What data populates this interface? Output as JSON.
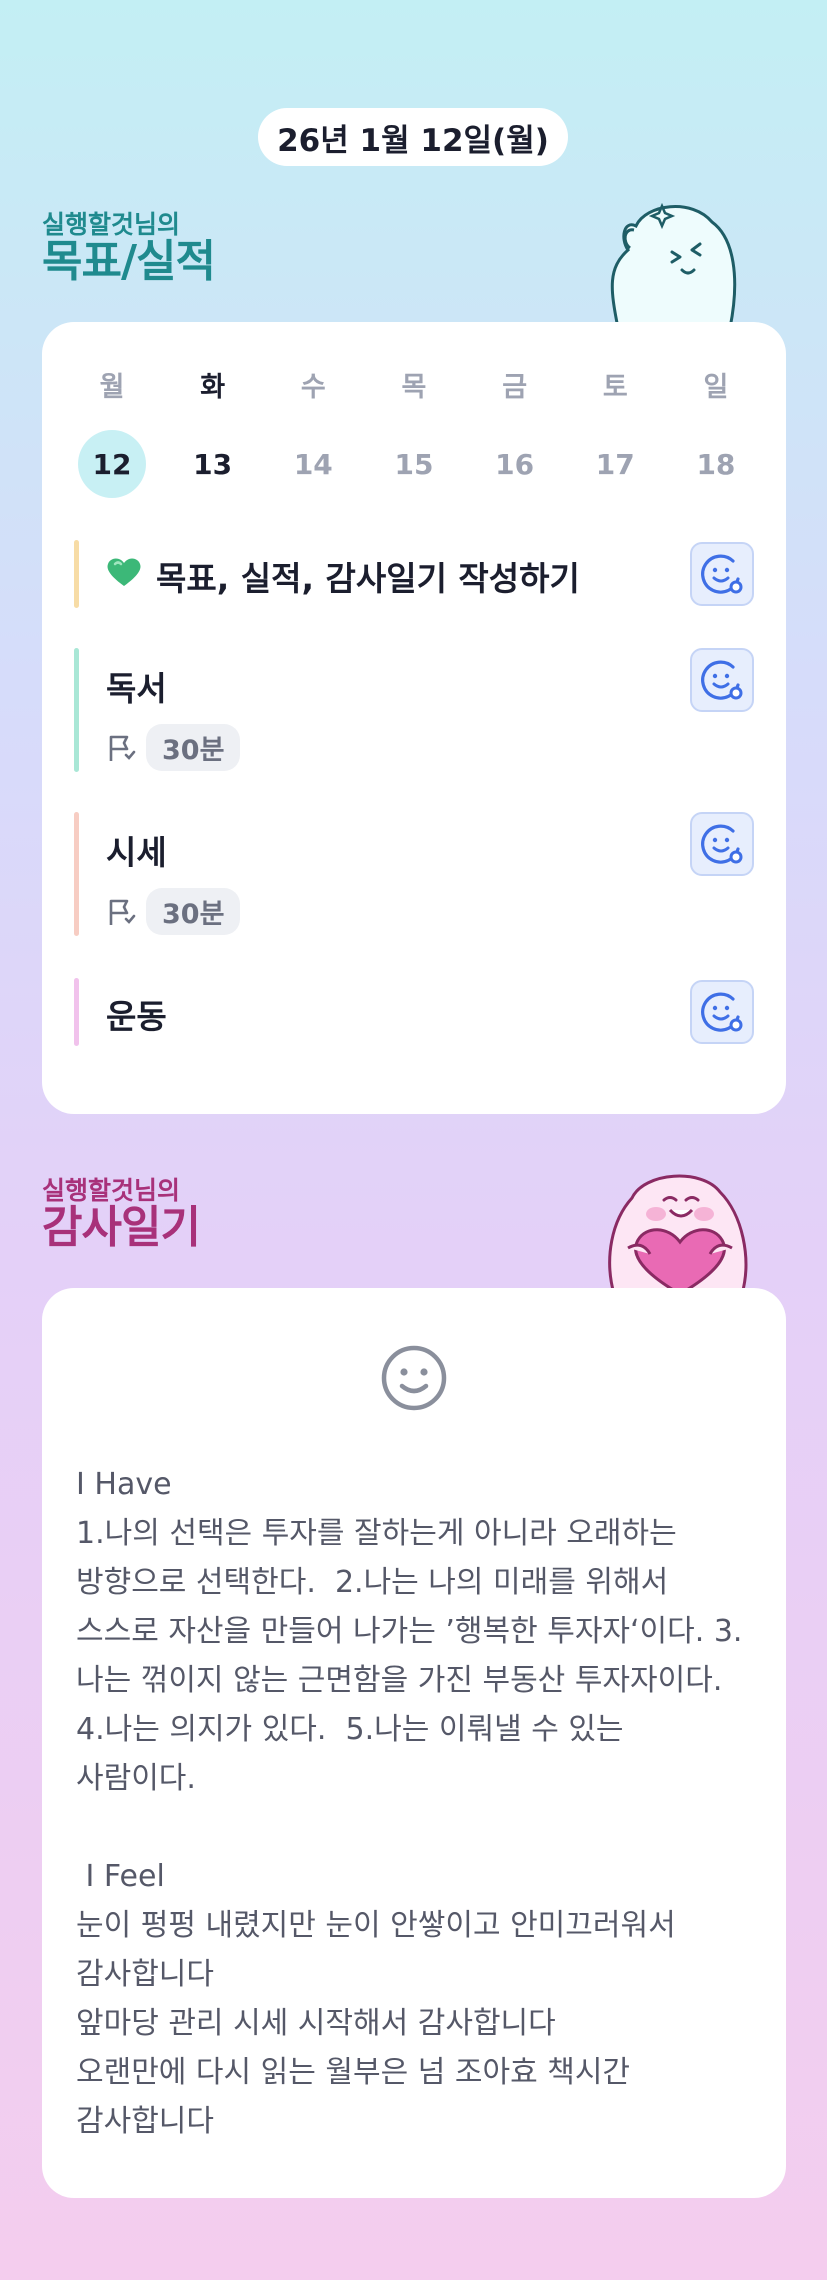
{
  "header": {
    "date": "26년 1월 12일(월)"
  },
  "goals": {
    "label_sub": "실행할것님의",
    "label_main": "목표/실적",
    "week": {
      "days": [
        "월",
        "화",
        "수",
        "목",
        "금",
        "토",
        "일"
      ],
      "dates": [
        "12",
        "13",
        "14",
        "15",
        "16",
        "17",
        "18"
      ],
      "selected_index": 0,
      "active_index": 1
    },
    "tasks": [
      {
        "title": "목표, 실적, 감사일기 작성하기",
        "icon": "green-heart-icon",
        "bar_color": "#f7dca6"
      },
      {
        "title": "독서",
        "duration": "30분",
        "bar_color": "#a9e7d6"
      },
      {
        "title": "시세",
        "duration": "30분",
        "bar_color": "#f7cdc3"
      },
      {
        "title": "운동",
        "bar_color": "#f1c2ec"
      }
    ]
  },
  "diary": {
    "label_sub": "실행할것님의",
    "label_main": "감사일기",
    "text": "I Have\n1.나의 선택은 투자를 잘하는게 아니라 오래하는 방향으로 선택한다.  2.나는 나의 미래를 위해서 스스로 자산을 만들어 나가는 ’행복한 투자자‘이다. 3.나는 꺾이지 않는 근면함을 가진 부동산 투자자이다. 4.나는 의지가 있다.  5.나는 이뤄낼 수 있는 사람이다.\n\n I Feel\n눈이 펑펑 내렸지만 눈이 안쌓이고 안미끄러워서 감사합니다\n앞마당 관리 시세 시작해서 감사합니다\n오랜만에 다시 읽는 월부은 넘 조아효 책시간 감사합니다"
  },
  "colors": {
    "goals_accent": "#1f8a8e",
    "diary_accent": "#a8317a",
    "today_bg": "#c8f0f4",
    "reaction_icon": "#3f6fe6"
  }
}
